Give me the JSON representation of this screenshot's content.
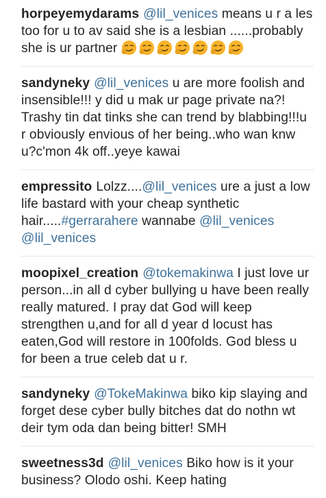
{
  "colors": {
    "username": "#262626",
    "link": "#3f729b",
    "text": "#262626",
    "emoji": "#f7b32b"
  },
  "comments": [
    {
      "user": "horpeyemydarams",
      "parts": [
        {
          "type": "mention",
          "text": "@lil_venices"
        },
        {
          "type": "text",
          "text": " means u r a les too for u to av said she is a lesbian ......probably she is ur partner "
        },
        {
          "type": "emoji",
          "icon": "smirk-face-emoji",
          "count": 7
        }
      ]
    },
    {
      "user": "sandyneky",
      "parts": [
        {
          "type": "mention",
          "text": "@lil_venices"
        },
        {
          "type": "text",
          "text": " u are more foolish and insensible!!! y did u mak ur page private na?! Trashy tin dat tinks she can trend by blabbing!!!u r obviously envious of her being..who wan knw u?c'mon 4k off..yeye kawai"
        }
      ]
    },
    {
      "user": "empressito",
      "parts": [
        {
          "type": "text",
          "text": "Lolzz...."
        },
        {
          "type": "mention",
          "text": "@lil_venices"
        },
        {
          "type": "text",
          "text": " ure a just a low life bastard with your cheap synthetic hair....."
        },
        {
          "type": "hashtag",
          "text": "#gerrarahere"
        },
        {
          "type": "text",
          "text": " wannabe "
        },
        {
          "type": "mention",
          "text": "@lil_venices"
        },
        {
          "type": "text",
          "text": " "
        },
        {
          "type": "mention",
          "text": "@lil_venices"
        }
      ]
    },
    {
      "user": "moopixel_creation",
      "parts": [
        {
          "type": "mention",
          "text": "@tokemakinwa"
        },
        {
          "type": "text",
          "text": " I just love ur person...in all d cyber bullying u have been really really matured. I pray dat God will keep strengthen u,and for all d year d locust has eaten,God will restore in 100folds. God bless u for been a true celeb dat u r."
        }
      ]
    },
    {
      "user": "sandyneky",
      "parts": [
        {
          "type": "mention",
          "text": "@TokeMakinwa"
        },
        {
          "type": "text",
          "text": " biko kip slaying and forget dese cyber bully bitches dat do nothn wt deir tym oda dan being bitter! SMH"
        }
      ]
    },
    {
      "user": "sweetness3d",
      "parts": [
        {
          "type": "mention",
          "text": "@lil_venices"
        },
        {
          "type": "text",
          "text": " Biko how is it your business? Olodo oshi. Keep hating"
        }
      ]
    }
  ]
}
